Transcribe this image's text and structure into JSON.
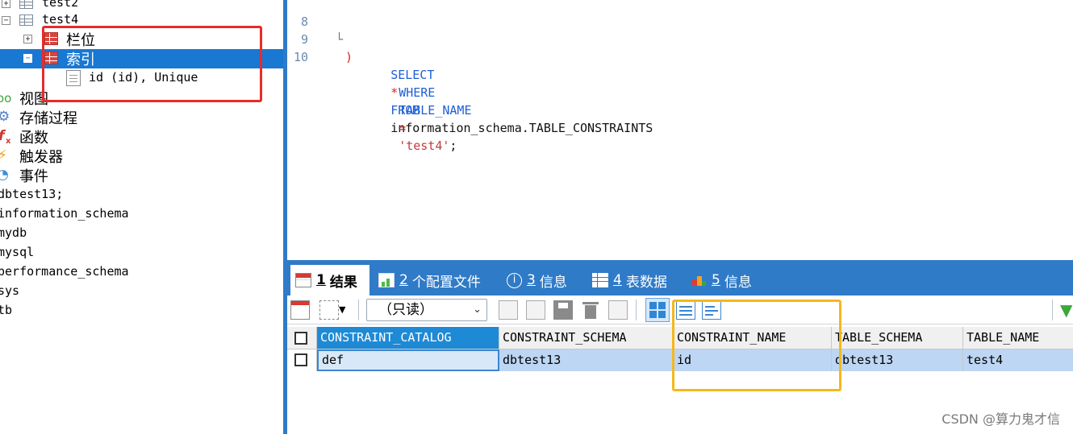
{
  "tree": {
    "rows": [
      {
        "label": "test2"
      },
      {
        "label": "test4"
      },
      {
        "label": "栏位"
      },
      {
        "label": "索引"
      },
      {
        "label": "id (id), Unique"
      },
      {
        "label": "视图"
      },
      {
        "label": "存储过程"
      },
      {
        "label": "函数"
      },
      {
        "label": "触发器"
      },
      {
        "label": "事件"
      },
      {
        "label": "dbtest13;"
      },
      {
        "label": "information_schema"
      },
      {
        "label": "mydb"
      },
      {
        "label": "mysql"
      },
      {
        "label": "performance_schema"
      },
      {
        "label": "sys"
      },
      {
        "label": "tb"
      }
    ],
    "expander_plus": "+",
    "expander_minus": "−"
  },
  "editor": {
    "lines": [
      {
        "num": "8",
        "text": ")"
      },
      {
        "num": "9",
        "kw1": "SELECT",
        "star": "*",
        "kw2": "FROM",
        "rest": "information_schema.TABLE_CONSTRAINTS"
      },
      {
        "num": "10",
        "kw1": "WHERE",
        "ident": "TABLE_NAME",
        "eq": "=",
        "str": "'test4'",
        "end": ";"
      }
    ]
  },
  "result_tabs": [
    {
      "num": "1",
      "label": "结果"
    },
    {
      "num": "2",
      "label": "个配置文件"
    },
    {
      "num": "3",
      "label": "信息"
    },
    {
      "num": "4",
      "label": "表数据"
    },
    {
      "num": "5",
      "label": "信息"
    }
  ],
  "toolbar": {
    "readonly_select": "（只读）",
    "dropdown_arrow": "⌄"
  },
  "grid": {
    "columns": [
      "CONSTRAINT_CATALOG",
      "CONSTRAINT_SCHEMA",
      "CONSTRAINT_NAME",
      "TABLE_SCHEMA",
      "TABLE_NAME"
    ],
    "rows": [
      [
        "def",
        "dbtest13",
        "id",
        "dbtest13",
        "test4"
      ]
    ]
  },
  "watermark": "CSDN @算力鬼才信",
  "colors": {
    "selection_blue": "#1878d2",
    "red_highlight": "#e62c2c",
    "yellow_highlight": "#f5b81b",
    "tabbar_blue": "#2f7bc8"
  }
}
